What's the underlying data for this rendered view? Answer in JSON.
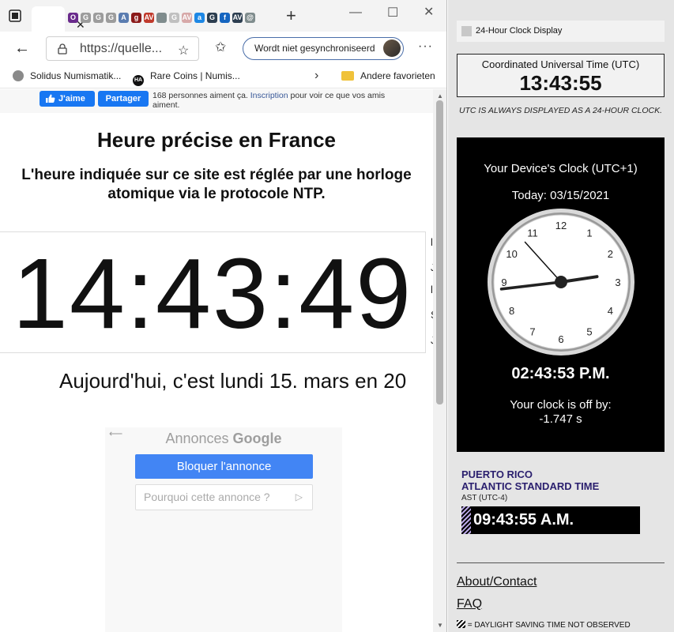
{
  "browser": {
    "url": "https://quelle...",
    "sync_label": "Wordt niet gesynchroniseerd",
    "favicon_letters": [
      "O",
      "G",
      "G",
      "G",
      "A",
      "g",
      "AV",
      "",
      "G",
      "AV",
      "a",
      "G",
      "f",
      "AV",
      "@"
    ],
    "bookmarks": [
      {
        "label": "Solidus Numismatik..."
      },
      {
        "label": "Rare Coins | Numis..."
      },
      {
        "label": "Andere favorieten"
      }
    ],
    "rare_coins_icon_text": "HA"
  },
  "page": {
    "fb_like": "J'aime",
    "fb_share": "Partager",
    "fb_text_before": "168 personnes aiment ça. ",
    "fb_link": "Inscription",
    "fb_text_after": " pour voir ce que vos amis aiment.",
    "title": "Heure précise en France",
    "subtitle": "L'heure indiquée sur ce site est réglée par une horloge atomique via le protocole NTP.",
    "big_time": "14:43:49",
    "side_letters": [
      "l",
      "J",
      "l",
      "S",
      "J"
    ],
    "today": "Aujourd'hui, c'est lundi 15. mars en 20",
    "ad_label_prefix": "Annonces ",
    "ad_label_brand": "Google",
    "ad_block": "Bloquer l'annonce",
    "ad_why": "Pourquoi cette annonce ?"
  },
  "panel": {
    "header": "24-Hour Clock Display",
    "utc_label": "Coordinated Universal Time (UTC)",
    "utc_time": "13:43:55",
    "utc_note": "UTC is always displayed as a 24-hour clock.",
    "device_title": "Your Device's Clock (UTC+1)",
    "device_today": "Today: 03/15/2021",
    "device_time": "02:43:53 P.M.",
    "clock_off_label": "Your clock is off by:",
    "clock_off_value": "-1.747 s",
    "analog": {
      "hours": 2,
      "minutes": 43,
      "seconds": 53
    },
    "pr_title_1": "PUERTO RICO",
    "pr_title_2": "ATLANTIC STANDARD TIME",
    "pr_sub": "AST (UTC-4)",
    "pr_time": "09:43:55 A.M.",
    "link_about": "About/Contact",
    "link_faq": "FAQ",
    "dst_note": " = DAYLIGHT SAVING TIME NOT OBSERVED"
  },
  "colors": {
    "fb_blue": "#1877f2",
    "google_blue": "#4285f4",
    "pr_purple": "#2a1f6e"
  }
}
